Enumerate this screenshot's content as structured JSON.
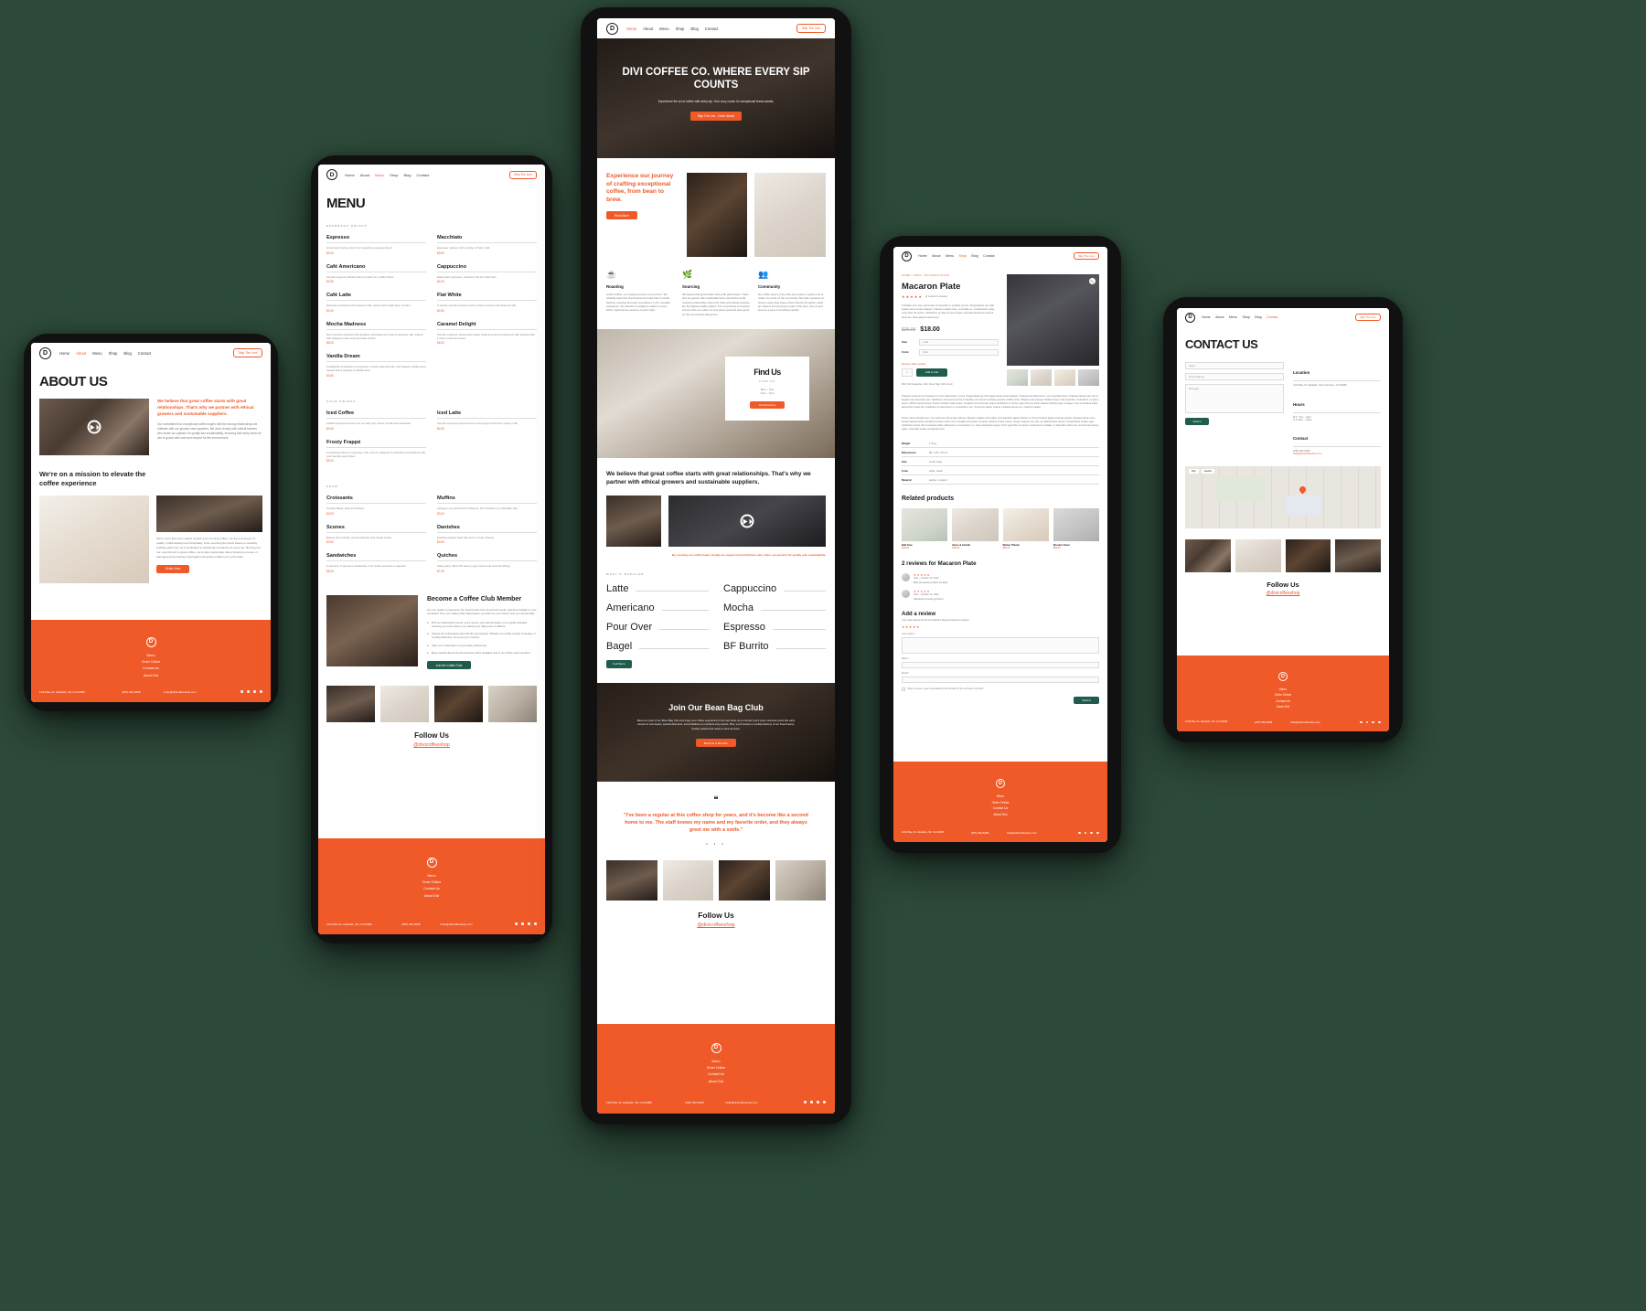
{
  "brand": {
    "name": "Divi Coffee Co.",
    "logo_letter": "D",
    "accent": "#F05A28",
    "dark": "#1b1b1b",
    "teal": "#1f5c4d",
    "background": "#2d4a3a"
  },
  "nav": {
    "items": [
      "Home",
      "About",
      "Menu",
      "Shop",
      "Blog",
      "Contact"
    ],
    "cta": "Skip The Line"
  },
  "about_page": {
    "device": "tablet-about",
    "active_nav": "About",
    "title": "ABOUT US",
    "lead": "We believe that great coffee starts with great relationships. That's why we partner with ethical growers and sustainable suppliers.",
    "lead_body": "Our commitment to exceptional coffee begins with the strong relationships we cultivate with our growers and suppliers. We work closely with ethical farmers who share our passion for quality and sustainability, ensuring that every bean we use is grown with care and respect for the environment.",
    "mission_heading": "We're on a mission to elevate the coffee experience",
    "mission_body": "We're more than just a place to grab your morning coffee; we are a purveyor of quality, craftsmanship and hospitality. From sourcing the finest beans to carefully crafting each cup, we're dedicated to delivering excellence in every sip. But beyond our commitment to great coffee, we're also passionate about fostering a sense of belonging and creating meaningful connections within our community.",
    "mission_button": "Order Now",
    "video_label": "play-video"
  },
  "menu_page": {
    "device": "tablet-menu",
    "active_nav": "Menu",
    "title": "MENU",
    "sections": [
      {
        "eyebrow": "ESPRESSO DRINKS",
        "left": [
          {
            "name": "Espresso",
            "desc": "A bold and intense shot of our signature espresso blend.",
            "price": "$3.00"
          },
          {
            "name": "Café Americano",
            "desc": "Smooth espresso diluted with hot water for a milder flavor.",
            "price": "$3.50"
          },
          {
            "name": "Café Latte",
            "desc": "Espresso combined with steamed milk, topped with a light layer of foam.",
            "price": "$4.00"
          },
          {
            "name": "Mocha Madness",
            "desc": "Rich espresso blended with decadent chocolate and creamy steamed milk, topped with whipped cream and chocolate drizzle.",
            "price": "$5.00"
          },
          {
            "name": "Vanilla Dream",
            "desc": "A delightful combination of espresso, velvety steamed milk, and fragrant vanilla syrup topped with a sprinkle of vanilla bean.",
            "price": "$4.50"
          }
        ],
        "right": [
          {
            "name": "Macchiato",
            "desc": "Espresso 'stained' with a dollop of frothy milk.",
            "price": "$3.50"
          },
          {
            "name": "Cappuccino",
            "desc": "Equal parts espresso, steamed milk and milk foam.",
            "price": "$4.00"
          },
          {
            "name": "Flat White",
            "desc": "A velvety smooth espresso with a creamy texture and steamed milk.",
            "price": "$4.50"
          },
          {
            "name": "Caramel Delight",
            "desc": "Smooth espresso infused with sweet caramel syrup and steamed milk, finished with a swirl of caramel sauce.",
            "price": "$5.00"
          }
        ]
      },
      {
        "eyebrow": "COLD DRINKS",
        "left": [
          {
            "name": "Iced Coffee",
            "desc": "Chilled espresso served over ice with your choice of milk and sweetener.",
            "price": "$3.50"
          },
          {
            "name": "Frosty Frappé",
            "desc": "A refreshing blend of espresso, milk, and ice, whipped to perfection and finished with your favorite syrup flavor.",
            "price": "$5.00"
          }
        ],
        "right": [
          {
            "name": "Iced Latte",
            "desc": "Smooth espresso poured over ice and topped with cold, creamy milk.",
            "price": "$4.50"
          }
        ]
      },
      {
        "eyebrow": "FOOD",
        "left": [
          {
            "name": "Croissants",
            "desc": "Freshly baked, flaky and buttery.",
            "price": "$3.00"
          },
          {
            "name": "Scones",
            "desc": "Buttery and crumbly, served with jam and clotted cream.",
            "price": "$3.50"
          },
          {
            "name": "Sandwiches",
            "desc": "A selection of gourmet sandwiches, from turkey avocado to caprese.",
            "price": "$8.00"
          }
        ],
        "right": [
          {
            "name": "Muffins",
            "desc": "Indulge in our assortment of flavors, from blueberry to chocolate chip.",
            "price": "$3.00"
          },
          {
            "name": "Danishes",
            "desc": "Delicate pastries filled with fruit or cream cheese.",
            "price": "$3.50"
          },
          {
            "name": "Quiches",
            "desc": "Flaky pastry filled with savory egg custard and assorted fillings.",
            "price": "$7.00"
          }
        ]
      }
    ],
    "club": {
      "heading": "Become a Coffee Club Member",
      "intro": "Are you ready to experience the finest beans from around the world, delivered straight to your doorstep? Then our Coffee Club Subscription is perfect for you! Here's how you should start:",
      "steps": [
        "Pick our subscription period, you'll receive your favored beans on a regular schedule, ensuring you never have to go without your daily dose of caffeine.",
        "Choose the subscription plan that fits your lifestyle. Whether you prefer weekly, bi-weekly, or monthly deliveries, we've got you covered.",
        "Tailor your subscription to your taste preferences.",
        "Enjoy special discounts and exclusive offers available only to our Coffee Club members."
      ],
      "button": "Join the Coffee Club"
    },
    "gallery": [
      "coffee-pour",
      "latte-art",
      "beans",
      "barista"
    ],
    "follow": {
      "title": "Follow Us",
      "handle": "@divicoffeeshop"
    }
  },
  "home_page": {
    "device": "phone-home",
    "active_nav": "Home",
    "hero": {
      "title": "DIVI COFFEE CO. WHERE EVERY SIP COUNTS",
      "subtitle": "Experience the art of coffee with every sip. Your cozy corner for exceptional brews awaits.",
      "cta": "Skip The Line - Order Ahead"
    },
    "intro": {
      "heading": "Experience our journey of crafting exceptional coffee, from bean to brew.",
      "button": "Read More"
    },
    "features": [
      {
        "icon": "cup-icon",
        "title": "Roasting",
        "body": "At Divi Coffee, our roasting process is an art form. We carefully select the finest beans and roast them in small batches, ensuring that each cup delivers a rich, aromatic experience. Our attention to quality is evident in every batch, capturing the essence of each origin."
      },
      {
        "icon": "leaf-icon",
        "title": "Sourcing",
        "body": "We believe that great coffee starts with great beans. That's why we partner with sustainable farms around the world, fostering relationships where fair trade and ethical practices are the highest quality coffees. Our commitment to sourcing ensures that our coffee not only tastes great but does good for the communities that grow it."
      },
      {
        "icon": "people-icon",
        "title": "Community",
        "body": "Our coffee shop is more than just a place to grab a cup of coffee; it's a hub for the community. We pride ourselves on being a welcoming space where friends can gather, ideas are shared, and everyone is part of the story. Join us and become a part of something special."
      }
    ],
    "find_us": {
      "eyebrow": "FIND US",
      "title": "Find Us",
      "line1": "Mon – Sun",
      "line2": "7am – 7pm",
      "button": "Get Directions"
    },
    "relationships": "We believe that great coffee starts with great relationships. That's why we partner with ethical growers and sustainable suppliers.",
    "sourcing_note": "By sourcing our coffee beans locally, we support trusted farmers who share our passion for quality and sustainability.",
    "popular": {
      "eyebrow": "WHAT'S POPULAR",
      "left": [
        "Latte",
        "Americano",
        "Pour Over",
        "Bagel"
      ],
      "right": [
        "Cappuccino",
        "Mocha",
        "Espresso",
        "BF Burrito"
      ],
      "button": "Full Menu"
    },
    "bean_club": {
      "title": "Join Our Bean Bag Club",
      "body": "Become a part of our Bean Bag Club and enjoy your coffee experience to the next level. As a member you'll enjoy exclusive perks like early access to new beans, special discounts, and invitations to members-only events. Plus, you'll receive a monthly delivery of our finest beans, freshly roasted and ready to brew at home.",
      "button": "Become a Member"
    },
    "testimonial": {
      "quote": "\"I've been a regular at this coffee shop for years, and it's become like a second home to me. The staff knows my name and my favorite order, and they always greet me with a smile.\"",
      "dots": 3
    },
    "gallery": [
      "coffee-pour",
      "latte-art",
      "beans",
      "barista"
    ],
    "follow": {
      "title": "Follow Us",
      "handle": "@divicoffeeshop"
    }
  },
  "product_page": {
    "device": "phone-product",
    "active_nav": "Shop",
    "breadcrumb": "HOME / SHOP / MACARON PLATE",
    "title": "Macaron Plate",
    "rating": "★★★★★",
    "reviews_label": "(2 customer reviews)",
    "short_desc": "Curabitur arcu erat, accumsan id imperdiet et, porttitor at sem. Suspendisse nec nibh sapien lacus ornare aliquam. Praesent sapien ante, venenatis ac, condimentum vitae, commodo vel, lectus. Vestibulum ac diam sit amet quam vehicula elementum sed sit amet dui. Vitae aliquet elementum.",
    "price_old": "$25.00",
    "price_new": "$18.00",
    "options": [
      {
        "label": "Size",
        "value": "small"
      },
      {
        "label": "Color",
        "value": "white"
      }
    ],
    "qty_label": "Macaron Plate quantity",
    "qty_value": "1",
    "add_to_cart": "Add to cart",
    "meta": "SKU: N/A   Categories: Gifts, Decor   Tags: Gifts, Decor",
    "description": "Praesent ut ipsum dui. Praesent et nunc ullamcorper, ornare. Suspendisse ac nibh sapien lacus ornare aliquam. Praesent sit tellus lorem, non imperdiet ipsum. Praesent laoreet elit, nec id feugiat ante accumsan sed. Vestibulum ante ipsum primis in faucibus orci luctus et ultrices posuere cubilia curae. Aliquam erat volutpat. Nullam tempor erat imperdiet. Ut tincidunt, ex quam ipsum, efficitur laoreet ipsum. Donec tincidunt nulla neque. Curabitur vel accumsan augue vestibulum ut. Donec eget tortor ac ipsum aliquam lobortis eget ut augue. Cras ut tincidunt tellus, elementum luctus elit. Vestibulum et elementum ut, consectetur nec. Ut tempus sapien magna, molestie augue nec, maximus sapien.",
    "spec_intro": "Donec rutrum lobortis sem, nec maximus nisl semper ultrices. Aliquam sodales tortor tellus, sed imperdiet sapien efficitur ut. Proin tincidunt ligula et lacinia semper. Quisque lectus risus, tempor laoreet luctus, hendrerit posuere tortor nunc. Fringilla sed pretium sit amet, ultricies ornare mauris, tempor magna enim nisl, nec blandit dolor tempor. Suspendisse tempus eget. Vestibulum luctus nisl consequat mattis. Maecenas ut consectetur ex, vitae scelerisque augue. Proin eget dolor vel quam condimentum sodales. In bibendum odio urna, sit amet fermentum quam, venenatis a diam vel egestas sed.",
    "specs": [
      {
        "label": "Weight",
        "value": "1.5 kg"
      },
      {
        "label": "Dimensions",
        "value": "80 × 35 × 45 cm"
      },
      {
        "label": "Size",
        "value": "small, large"
      },
      {
        "label": "Color",
        "value": "white, black"
      },
      {
        "label": "Material",
        "value": "leather, ceramic"
      }
    ],
    "related_heading": "Related products",
    "related": [
      {
        "name": "Ball Vase",
        "price": "$42.00"
      },
      {
        "name": "Glass & Candle",
        "price": "$38.00"
      },
      {
        "name": "Wicker Planter",
        "price": "$56.00"
      },
      {
        "name": "Wooden Stool",
        "price": "$88.00"
      }
    ],
    "reviews_heading": "2 reviews for Macaron Plate",
    "reviews": [
      {
        "author": "mike",
        "date": "October 12, 2022",
        "stars": "★★★★★",
        "text": "Best tea quality product we liked"
      },
      {
        "author": "mike",
        "date": "October 12, 2022",
        "stars": "★★★★★",
        "text": "Absolutely amazing product!"
      }
    ],
    "add_review_heading": "Add a review",
    "add_review_note": "Your email address will not be published. Required fields are marked *",
    "your_rating_label": "Your rating *",
    "review_field_label": "Your review *",
    "name_field_label": "Name *",
    "email_field_label": "Email *",
    "save_note": "Save my name, email, and website in this browser for the next time I comment.",
    "submit": "Submit"
  },
  "contact_page": {
    "device": "phone-contact",
    "active_nav": "Contact",
    "title": "CONTACT US",
    "form": {
      "name_placeholder": "Name",
      "email_placeholder": "Email Address",
      "message_placeholder": "Message",
      "submit": "Submit"
    },
    "info": [
      {
        "heading": "Location",
        "lines": [
          "1234 Bee St. Adelaide, San Francisco, CA 94080"
        ]
      },
      {
        "heading": "Hours",
        "lines": [
          "M-F: 7am – 9pm",
          "S-S: 8am – 10pm"
        ]
      },
      {
        "heading": "Contact",
        "lines": [
          "(255) 352-6258",
          "hello@divicoffeeshop.com"
        ]
      }
    ],
    "map": {
      "label": "Map",
      "satellite_label": "Satellite",
      "pin": "location-pin"
    },
    "gallery": [
      "barista",
      "latte-art",
      "beans",
      "machine"
    ],
    "follow": {
      "title": "Follow Us",
      "handle": "@divicoffeeshop"
    }
  },
  "footer": {
    "logo_letter": "D",
    "links": [
      "Menu",
      "Order Online",
      "Contact Us",
      "About Divi"
    ],
    "address": "1234 Bee St. Adelaide, SF, CA 94080",
    "phone": "(255) 352-6258",
    "email": "hello@divicoffeeshop.com",
    "social": [
      "facebook-icon",
      "twitter-icon",
      "instagram-icon",
      "dribbble-icon"
    ]
  }
}
